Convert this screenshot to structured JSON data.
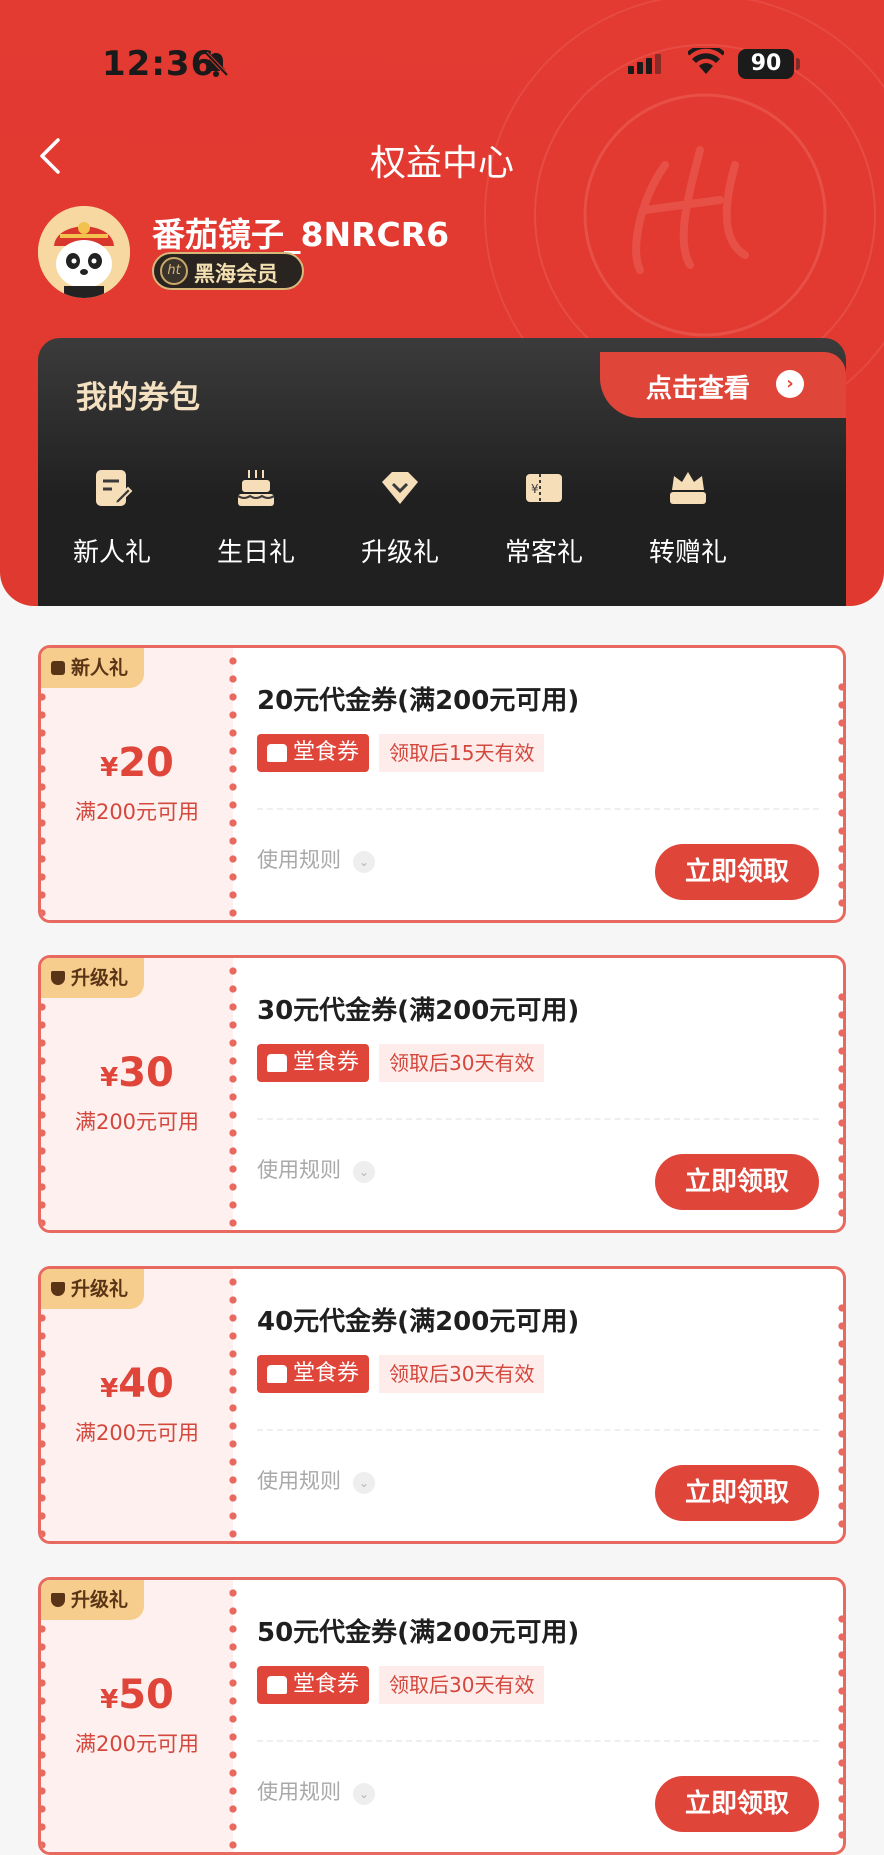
{
  "status_bar": {
    "time": "12:36",
    "battery": "90"
  },
  "nav": {
    "title": "权益中心"
  },
  "user": {
    "name": "番茄镜子_8NRCR6",
    "member_level": "黑海会员"
  },
  "wallet": {
    "title": "我的券包",
    "view_label": "点击查看",
    "gifts": [
      {
        "label": "新人礼",
        "icon": "note-icon"
      },
      {
        "label": "生日礼",
        "icon": "cake-icon"
      },
      {
        "label": "升级礼",
        "icon": "diamond-icon"
      },
      {
        "label": "常客礼",
        "icon": "ticket-icon"
      },
      {
        "label": "转赠礼",
        "icon": "crown-icon"
      }
    ]
  },
  "coupons": [
    {
      "tag": "新人礼",
      "currency": "¥",
      "amount": "20",
      "condition": "满200元可用",
      "title": "20元代金券(满200元可用)",
      "type": "堂食券",
      "validity": "领取后15天有效",
      "rules": "使用规则",
      "button": "立即领取"
    },
    {
      "tag": "升级礼",
      "currency": "¥",
      "amount": "30",
      "condition": "满200元可用",
      "title": "30元代金券(满200元可用)",
      "type": "堂食券",
      "validity": "领取后30天有效",
      "rules": "使用规则",
      "button": "立即领取"
    },
    {
      "tag": "升级礼",
      "currency": "¥",
      "amount": "40",
      "condition": "满200元可用",
      "title": "40元代金券(满200元可用)",
      "type": "堂食券",
      "validity": "领取后30天有效",
      "rules": "使用规则",
      "button": "立即领取"
    },
    {
      "tag": "升级礼",
      "currency": "¥",
      "amount": "50",
      "condition": "满200元可用",
      "title": "50元代金券(满200元可用)",
      "type": "堂食券",
      "validity": "领取后30天有效",
      "rules": "使用规则",
      "button": "立即领取"
    }
  ],
  "colors": {
    "brand_red": "#e0453a",
    "dark_panel": "#2a2a2a",
    "gold": "#f6cd8c"
  }
}
